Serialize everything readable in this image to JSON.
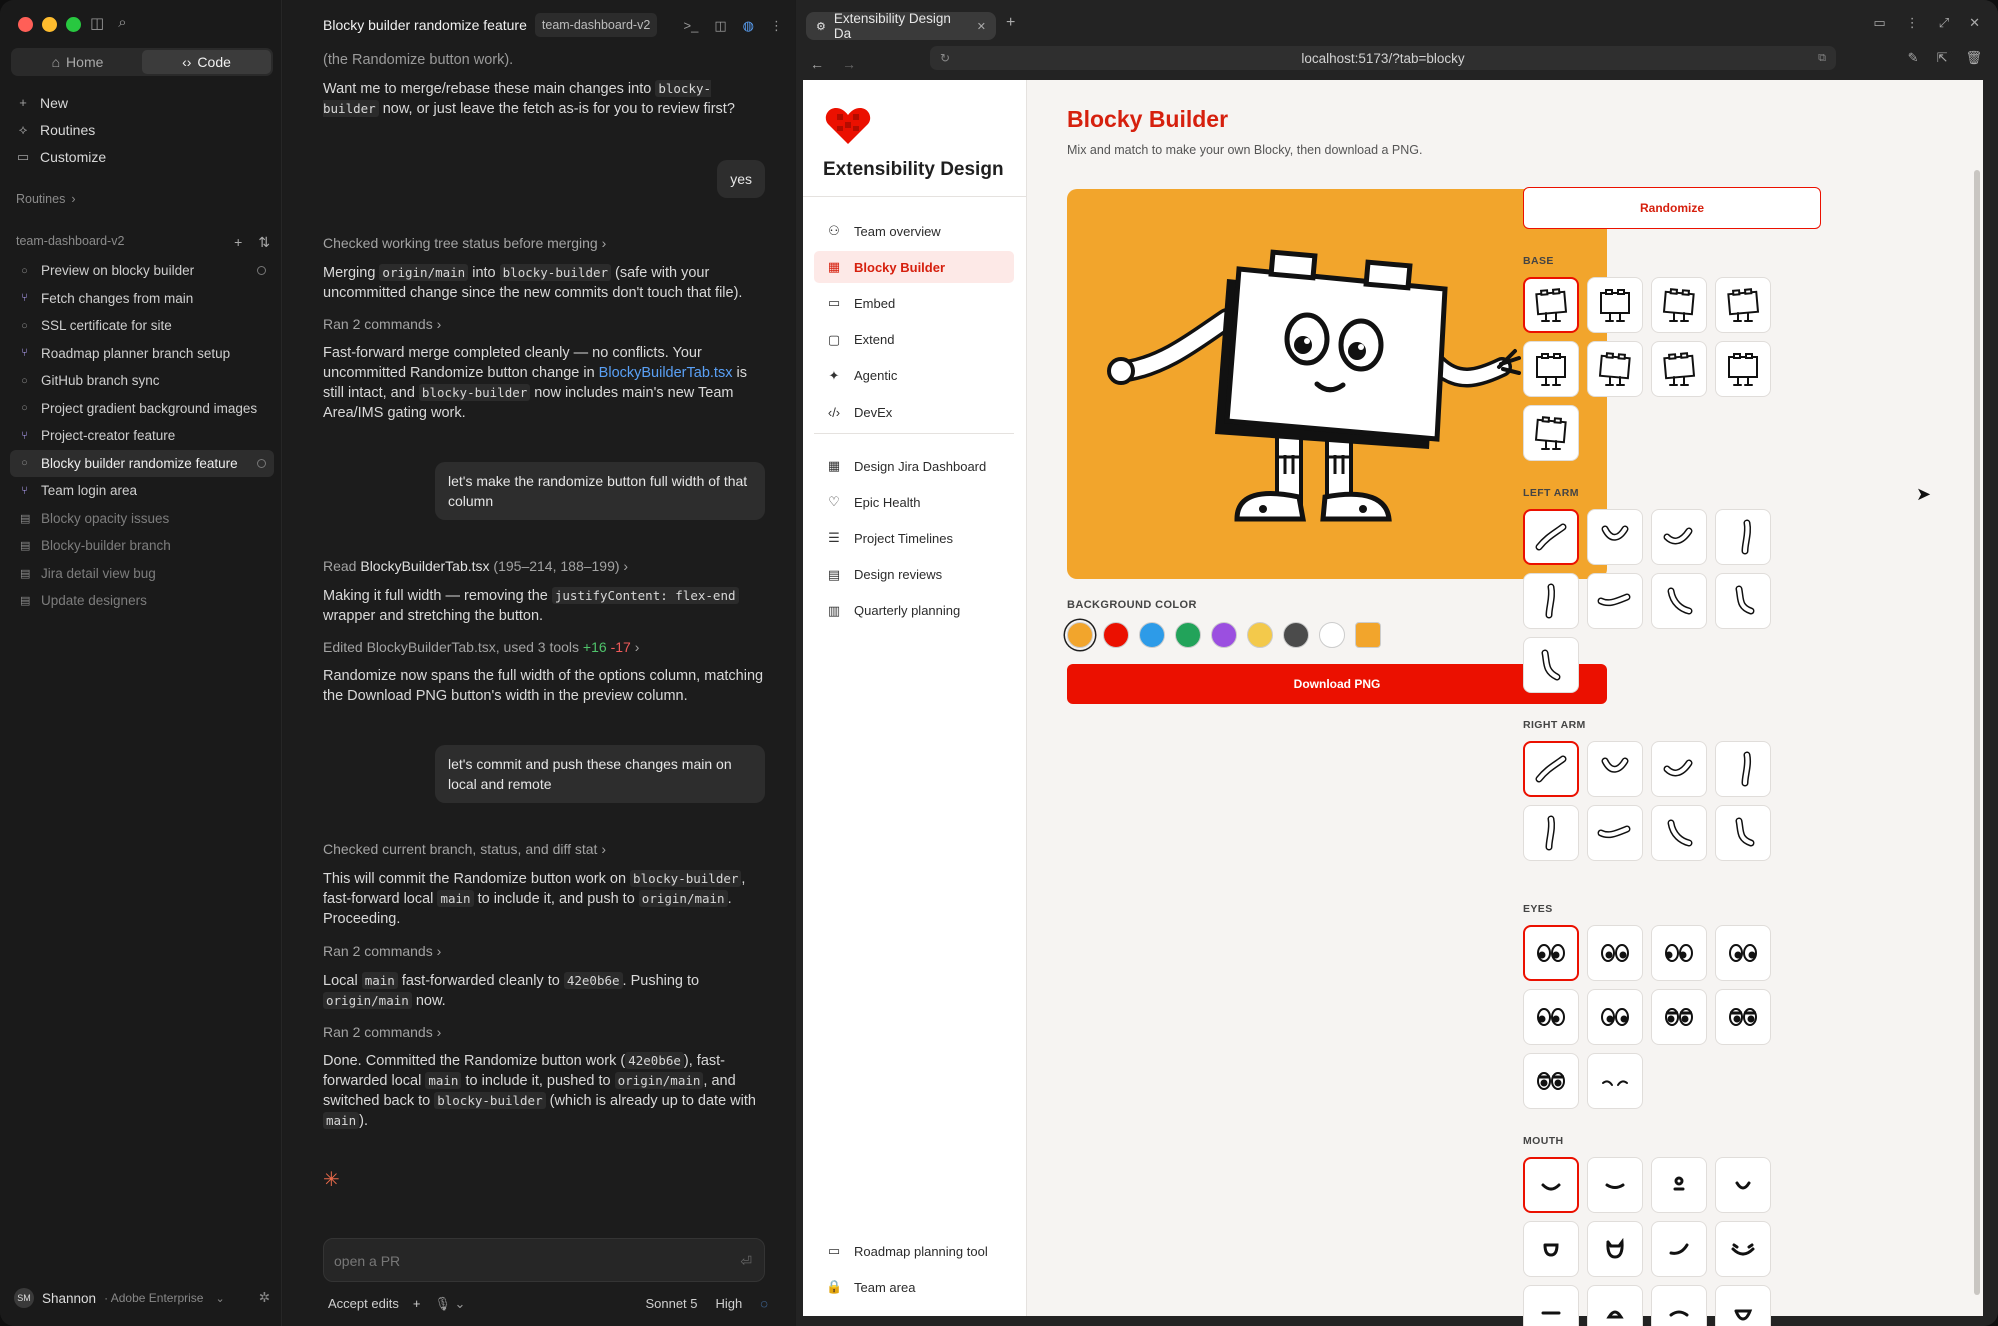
{
  "sidebar": {
    "seg": {
      "home": "Home",
      "code": "Code"
    },
    "nav": [
      {
        "label": "New",
        "icon": "plus-icon",
        "glyph": "+"
      },
      {
        "label": "Routines",
        "icon": "routines-icon",
        "glyph": "⟡"
      },
      {
        "label": "Customize",
        "icon": "customize-icon",
        "glyph": "▭"
      }
    ],
    "routines_header": "Routines",
    "repo": "team-dashboard-v2",
    "sessions": [
      {
        "label": "Preview on blocky builder",
        "type": "circle",
        "status": true
      },
      {
        "label": "Fetch changes from main",
        "type": "branch"
      },
      {
        "label": "SSL certificate for site",
        "type": "circle"
      },
      {
        "label": "Roadmap planner branch setup",
        "type": "branch"
      },
      {
        "label": "GitHub branch sync",
        "type": "circle"
      },
      {
        "label": "Project gradient background images",
        "type": "circle"
      },
      {
        "label": "Project-creator feature",
        "type": "branch"
      },
      {
        "label": "Blocky builder randomize feature",
        "type": "circle",
        "status": true,
        "active": true
      },
      {
        "label": "Team login area",
        "type": "branch"
      },
      {
        "label": "Blocky opacity issues",
        "type": "dim"
      },
      {
        "label": "Blocky-builder branch",
        "type": "dim"
      },
      {
        "label": "Jira detail view bug",
        "type": "dim"
      },
      {
        "label": "Update designers",
        "type": "dim"
      }
    ],
    "user": {
      "initials": "SM",
      "name": "Shannon",
      "org": "· Adobe Enterprise"
    }
  },
  "chat": {
    "title": "Blocky builder randomize feature",
    "branch_chip": "team-dashboard-v2",
    "m0": "(the Randomize button work).",
    "m1a": "Want me to merge/rebase these main changes into ",
    "m1code": "blocky-builder",
    "m1b": " now, or just leave the fetch as-is for you to review first?",
    "u1": "yes",
    "t1": "Checked working tree status before merging",
    "m2a": "Merging ",
    "m2c1": "origin/main",
    "m2b": " into ",
    "m2c2": "blocky-builder",
    "m2d": " (safe with your uncommitted change since the new commits don't touch that file).",
    "t2": "Ran 2 commands",
    "m3a": "Fast-forward merge completed cleanly — no conflicts. Your uncommitted Randomize button change in ",
    "m3link": "BlockyBuilderTab.tsx",
    "m3b": " is still intact, and ",
    "m3code": "blocky-builder",
    "m3c": " now includes main's new Team Area/IMS gating work.",
    "u2": "let's make the randomize button full width of that column",
    "t3a": "Read ",
    "t3file": "BlockyBuilderTab.tsx",
    "t3b": " (195–214, 188–199)",
    "m4a": "Making it full width — removing the ",
    "m4code": "justifyContent: flex-end",
    "m4b": " wrapper and stretching the button.",
    "t4": "Edited BlockyBuilderTab.tsx, used 3 tools",
    "t4add": "+16",
    "t4del": "-17",
    "m5": "Randomize now spans the full width of the options column, matching the Download PNG button's width in the preview column.",
    "u3": "let's commit and push these changes main on local and remote",
    "t5": "Checked current branch, status, and diff stat",
    "m6a": "This will commit the Randomize button work on ",
    "m6c1": "blocky-builder",
    "m6b": ", fast-forward local ",
    "m6c2": "main",
    "m6c": " to include it, and push to ",
    "m6c3": "origin/main",
    "m6d": ". Proceeding.",
    "t6": "Ran 2 commands",
    "m7a": "Local ",
    "m7c1": "main",
    "m7b": " fast-forwarded cleanly to ",
    "m7c2": "42e0b6e",
    "m7c": ". Pushing to ",
    "m7c3": "origin/main",
    "m7d": " now.",
    "t7": "Ran 2 commands",
    "m8a": "Done. Committed the Randomize button work (",
    "m8c1": "42e0b6e",
    "m8b": "), fast-forwarded local ",
    "m8c2": "main",
    "m8c": " to include it, pushed to ",
    "m8c3": "origin/main",
    "m8d": ", and switched back to ",
    "m8c4": "blocky-builder",
    "m8e": " (which is already up to date with ",
    "m8c5": "main",
    "m8f": ").",
    "input_placeholder": "open a PR",
    "accept": "Accept edits",
    "model": "Sonnet 5",
    "effort": "High"
  },
  "browser": {
    "tab_title": "Extensibility Design Da",
    "url": "localhost:5173/?tab=blocky"
  },
  "app": {
    "brand": "Extensibility Design",
    "nav_top": [
      {
        "label": "Team overview",
        "icon": "people-icon",
        "glyph": "⚇"
      },
      {
        "label": "Blocky Builder",
        "icon": "calendar-icon",
        "glyph": "▦",
        "active": true
      },
      {
        "label": "Embed",
        "icon": "embed-icon",
        "glyph": "▭"
      },
      {
        "label": "Extend",
        "icon": "extend-icon",
        "glyph": "▢"
      },
      {
        "label": "Agentic",
        "icon": "sparkle-icon",
        "glyph": "✦"
      },
      {
        "label": "DevEx",
        "icon": "code-icon",
        "glyph": "‹/›"
      }
    ],
    "nav_mid": [
      {
        "label": "Design Jira Dashboard",
        "icon": "grid-icon",
        "glyph": "▦"
      },
      {
        "label": "Epic Health",
        "icon": "heart-icon",
        "glyph": "♡"
      },
      {
        "label": "Project Timelines",
        "icon": "timeline-icon",
        "glyph": "☰"
      },
      {
        "label": "Design reviews",
        "icon": "review-icon",
        "glyph": "▤"
      },
      {
        "label": "Quarterly planning",
        "icon": "planning-icon",
        "glyph": "▥"
      }
    ],
    "nav_bottom": [
      {
        "label": "Roadmap planning tool",
        "icon": "roadmap-icon",
        "glyph": "▭"
      },
      {
        "label": "Team area",
        "icon": "lock-icon",
        "glyph": "🔒"
      }
    ],
    "title": "Blocky Builder",
    "subtitle": "Mix and match to make your own Blocky, then download a PNG.",
    "bg_label": "BACKGROUND COLOR",
    "bg_colors": [
      "#f2a52c",
      "#eb1000",
      "#2d9be8",
      "#22a35a",
      "#9b4fe0",
      "#f3c94b",
      "#4b4b4b",
      "#ffffff",
      "#f2a52c"
    ],
    "download": "Download PNG",
    "randomize": "Randomize",
    "groups": [
      {
        "label": "BASE",
        "count": 9,
        "kind": "base"
      },
      {
        "label": "LEFT ARM",
        "count": 9,
        "kind": "arm"
      },
      {
        "label": "RIGHT ARM",
        "count": 8,
        "kind": "arm"
      },
      {
        "label": "EYES",
        "count": 10,
        "kind": "eyes"
      },
      {
        "label": "MOUTH",
        "count": 12,
        "kind": "mouth"
      }
    ]
  }
}
